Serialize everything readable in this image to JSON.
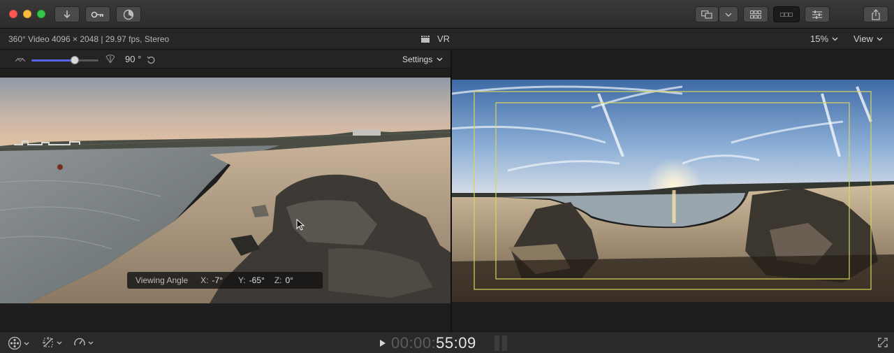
{
  "titlebar": {
    "traffic_lights": [
      "close",
      "minimize",
      "zoom"
    ],
    "buttons": [
      {
        "name": "import-button",
        "icon": "download-arrow-icon"
      },
      {
        "name": "keywords-button",
        "icon": "key-icon"
      },
      {
        "name": "background-tasks-button",
        "icon": "progress-circle-icon"
      },
      {
        "name": "viewer-display-button",
        "icon": "screens-icon"
      },
      {
        "name": "clip-appearance-button",
        "icon": "grid-icon"
      },
      {
        "name": "timeline-button",
        "icon": "filmstrip-icon"
      },
      {
        "name": "inspector-button",
        "icon": "sliders-icon"
      },
      {
        "name": "share-button",
        "icon": "share-icon"
      }
    ]
  },
  "infobar": {
    "format": "360° Video 4096 × 2048 | 29.97 fps, Stereo",
    "vr_label": "VR",
    "zoom": "15%",
    "view": "View"
  },
  "fov_controls": {
    "fov_value": "90 °",
    "fov_fraction": 0.65,
    "settings_label": "Settings"
  },
  "viewing_angle": {
    "label": "Viewing Angle",
    "x_label": "X:",
    "x_value": "-7°",
    "y_label": "Y:",
    "y_value": "-65°",
    "z_label": "Z:",
    "z_value": "0°"
  },
  "playback": {
    "timecode_dim": "00:00:",
    "timecode_bright": "55:09"
  },
  "colors": {
    "accent": "#5b63e8",
    "overlay_guides": "#d7d65a",
    "close": "#fc5753",
    "minimize": "#fdbc40",
    "zoom": "#33c748"
  }
}
